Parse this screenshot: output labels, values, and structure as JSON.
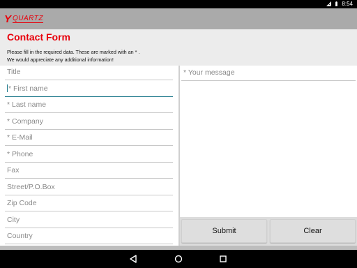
{
  "status_bar": {
    "time": "8:54"
  },
  "app": {
    "logo_mark": "Y",
    "logo_text": "QUARTZ"
  },
  "page": {
    "title": "Contact Form",
    "instructions_line1": "Please fill in the required data. These are marked with an * .",
    "instructions_line2": "We would appreciate any additional information!"
  },
  "form": {
    "fields": [
      {
        "name": "title",
        "placeholder": "Title"
      },
      {
        "name": "first-name",
        "placeholder": "* First name"
      },
      {
        "name": "last-name",
        "placeholder": "* Last name"
      },
      {
        "name": "company",
        "placeholder": "* Company"
      },
      {
        "name": "email",
        "placeholder": "* E-Mail"
      },
      {
        "name": "phone",
        "placeholder": "* Phone"
      },
      {
        "name": "fax",
        "placeholder": "Fax"
      },
      {
        "name": "street",
        "placeholder": "Street/P.O.Box"
      },
      {
        "name": "zip",
        "placeholder": "Zip Code"
      },
      {
        "name": "city",
        "placeholder": "City"
      },
      {
        "name": "country",
        "placeholder": "Country"
      }
    ],
    "message_placeholder": "* Your message",
    "submit_label": "Submit",
    "clear_label": "Clear"
  },
  "colors": {
    "brand": "#e8000b",
    "focus": "#1f7a8c"
  },
  "icons": [
    "signal-icon",
    "battery-icon",
    "back-icon",
    "home-icon",
    "recents-icon"
  ]
}
